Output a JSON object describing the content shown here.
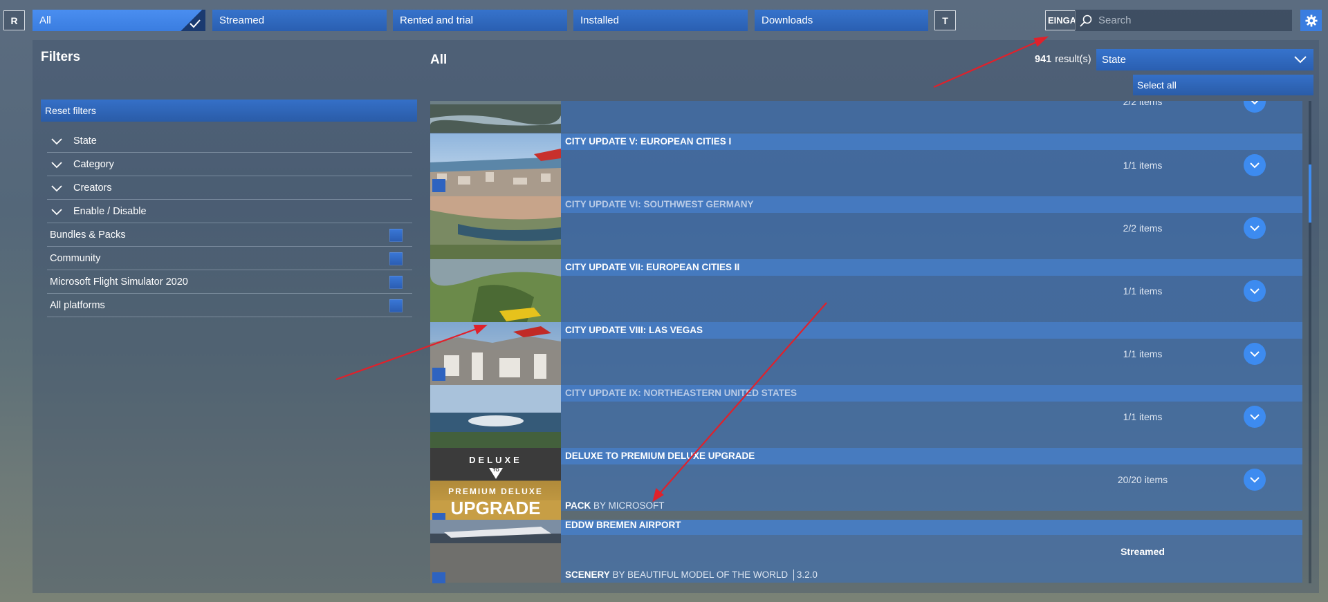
{
  "topbar": {
    "left_button": "R",
    "tabs": [
      {
        "label": "All",
        "active": true
      },
      {
        "label": "Streamed",
        "active": false
      },
      {
        "label": "Rented and trial",
        "active": false
      },
      {
        "label": "Installed",
        "active": false
      },
      {
        "label": "Downloads",
        "active": false
      }
    ],
    "right_button": "T",
    "search_prefix": "EINGA",
    "search_placeholder": "Search"
  },
  "filters": {
    "title": "Filters",
    "reset_label": "Reset filters",
    "collapsible": [
      "State",
      "Category",
      "Creators",
      "Enable / Disable"
    ],
    "checkboxes": [
      "Bundles & Packs",
      "Community",
      "Microsoft Flight Simulator 2020",
      "All platforms"
    ]
  },
  "list": {
    "title": "All",
    "result_count": "941",
    "result_suffix": "result(s)",
    "sort_value": "State",
    "select_all_label": "Select all",
    "rows": [
      {
        "title": "",
        "items": "2/2 items"
      },
      {
        "title": "CITY UPDATE V: EUROPEAN CITIES I",
        "items": "1/1 items"
      },
      {
        "title": "CITY UPDATE VI: SOUTHWEST GERMANY",
        "items": "2/2 items"
      },
      {
        "title": "CITY UPDATE VII: EUROPEAN CITIES II",
        "items": "1/1 items"
      },
      {
        "title": "CITY UPDATE VIII: LAS VEGAS",
        "items": "1/1 items"
      },
      {
        "title": "CITY UPDATE IX: NORTHEASTERN UNITED STATES",
        "items": "1/1 items"
      },
      {
        "title": "DELUXE TO PREMIUM DELUXE UPGRADE",
        "items": "20/20 items",
        "subtitle_type": "PACK",
        "subtitle_by": "BY MICROSOFT"
      },
      {
        "title": "EDDW BREMEN AIRPORT",
        "items": "Streamed",
        "subtitle_type": "SCENERY",
        "subtitle_by": "BY BEAUTIFUL MODEL OF THE WORLD",
        "version": "3.2.0"
      }
    ],
    "upgrade_thumb": {
      "line1": "DELUXE",
      "badge": "TO",
      "line2": "PREMIUM DELUXE",
      "line3": "UPGRADE"
    }
  },
  "colors": {
    "accent": "#3a7de0",
    "annotation": "#e0212b"
  }
}
